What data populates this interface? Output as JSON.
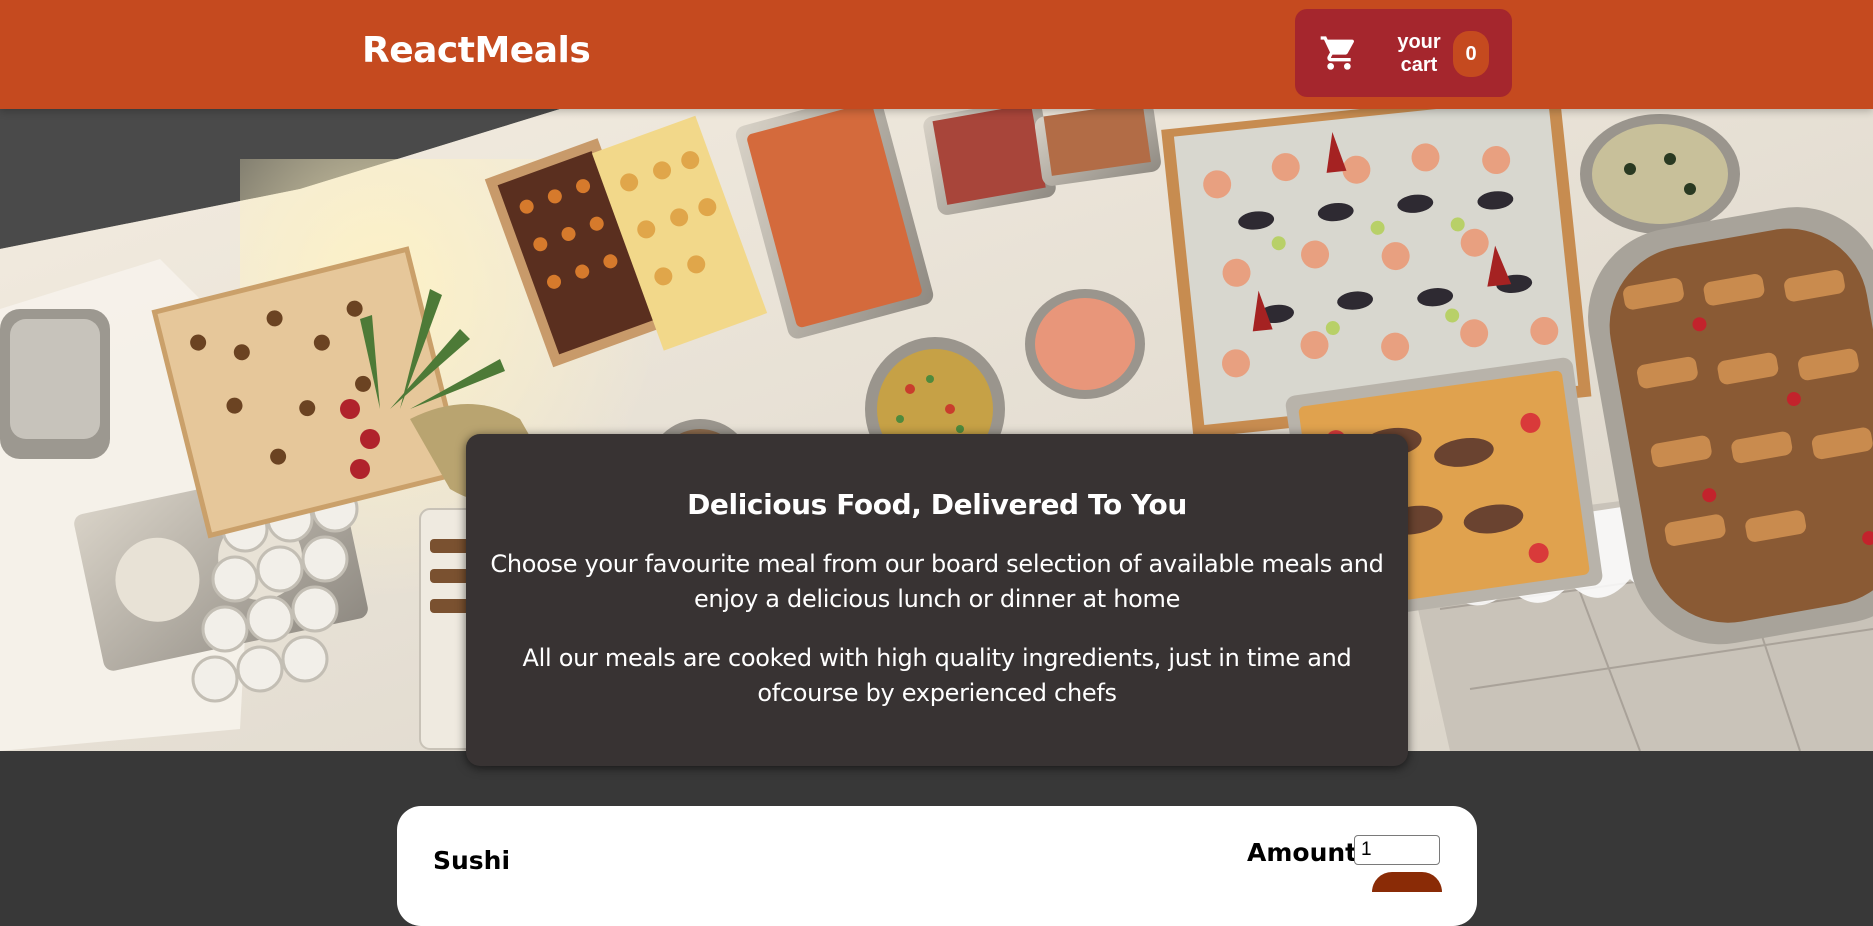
{
  "header": {
    "logo": "ReactMeals",
    "cart": {
      "label": "your cart",
      "count": "0",
      "icon": "shopping-cart-icon"
    }
  },
  "summary": {
    "title": "Delicious Food, Delivered To You",
    "paragraph_1": "Choose your favourite meal from our board selection of available meals and enjoy a delicious lunch or dinner at home",
    "paragraph_2": "All our meals are cooked with high quality ingredients, just in time and ofcourse by experienced chefs"
  },
  "meals": [
    {
      "name": "Sushi",
      "amount_label": "Amount",
      "amount_value": "1"
    }
  ],
  "colors": {
    "header": "#c54a1f",
    "cart_button": "#a5262d",
    "summary_bg": "#383333",
    "page_bg": "#383838"
  }
}
